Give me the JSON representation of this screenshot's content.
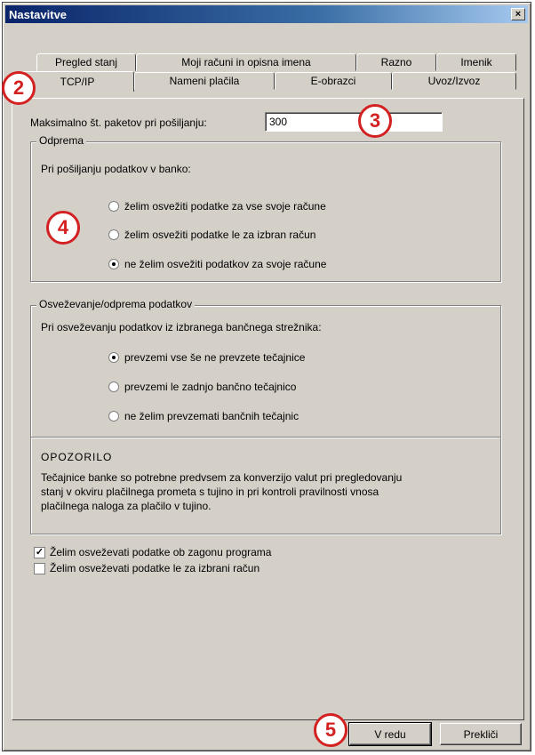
{
  "window": {
    "title": "Nastavitve",
    "close_glyph": "×"
  },
  "tabs_row1": [
    "Pregled stanj",
    "Moji računi in opisna imena",
    "Razno",
    "Imenik"
  ],
  "tabs_row2": [
    "TCP/IP",
    "Nameni plačila",
    "E-obrazci",
    "Uvoz/Izvoz"
  ],
  "active_tab": "TCP/IP",
  "packets": {
    "label": "Maksimalno št. paketov pri pošiljanju:",
    "value": "300"
  },
  "odprema": {
    "legend": "Odprema",
    "prompt": "Pri pošiljanju podatkov v banko:",
    "options": [
      {
        "label": "želim osvežiti podatke za vse svoje račune",
        "checked": false
      },
      {
        "label": "želim osvežiti podatke le za izbran račun",
        "checked": false
      },
      {
        "label": "ne želim osvežiti podatkov za svoje račune",
        "checked": true
      }
    ]
  },
  "osvezevanje": {
    "legend": "Osveževanje/odprema podatkov",
    "prompt": "Pri osveževanju podatkov iz izbranega bančnega strežnika:",
    "options": [
      {
        "label": "prevzemi vse še ne prevzete tečajnice",
        "checked": true
      },
      {
        "label": "prevzemi le zadnjo bančno tečajnico",
        "checked": false
      },
      {
        "label": "ne želim prevzemati bančnih tečajnic",
        "checked": false
      }
    ]
  },
  "warning": {
    "title": "OPOZORILO",
    "text": "Tečajnice banke so potrebne predvsem za konverzijo valut pri pregledovanju stanj v okviru plačilnega prometa s tujino in pri kontroli pravilnosti vnosa plačilnega naloga za plačilo v tujino."
  },
  "checkboxes": [
    {
      "label": "Želim osveževati podatke ob zagonu programa",
      "checked": true
    },
    {
      "label": "Želim osveževati podatke le za izbrani račun",
      "checked": false
    }
  ],
  "buttons": {
    "ok": "V redu",
    "cancel": "Prekliči"
  },
  "annotations": {
    "badge2": "2",
    "badge3": "3",
    "badge4": "4",
    "badge5": "5"
  },
  "colors": {
    "annotation_red": "#d32020",
    "titlebar": "#0a246a"
  }
}
